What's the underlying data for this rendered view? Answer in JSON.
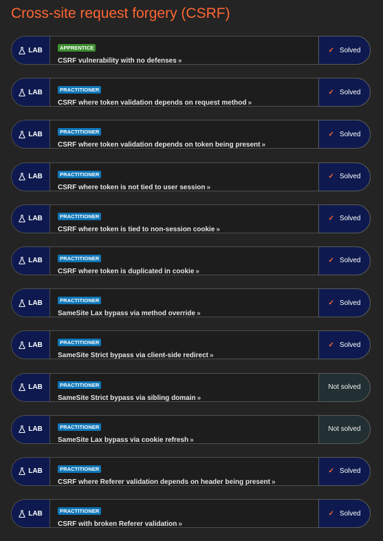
{
  "page_title": "Cross-site request forgery (CSRF)",
  "lab_badge_label": "LAB",
  "colors": {
    "title_accent": "#ff6633",
    "lab_badge_bg": "#0e1a4f",
    "apprentice": "#3e8f31",
    "practitioner": "#0f76b7",
    "solved_bg": "#0e1a4f",
    "not_solved_bg": "#233033"
  },
  "icons": {
    "badge": "flask-icon",
    "link": "double-chevron-right-icon",
    "solved": "check-icon"
  },
  "labs": [
    {
      "level": "APPRENTICE",
      "title": "CSRF vulnerability with no defenses",
      "status": "Solved"
    },
    {
      "level": "PRACTITIONER",
      "title": "CSRF where token validation depends on request method",
      "status": "Solved"
    },
    {
      "level": "PRACTITIONER",
      "title": "CSRF where token validation depends on token being present",
      "status": "Solved"
    },
    {
      "level": "PRACTITIONER",
      "title": "CSRF where token is not tied to user session",
      "status": "Solved"
    },
    {
      "level": "PRACTITIONER",
      "title": "CSRF where token is tied to non-session cookie",
      "status": "Solved"
    },
    {
      "level": "PRACTITIONER",
      "title": "CSRF where token is duplicated in cookie",
      "status": "Solved"
    },
    {
      "level": "PRACTITIONER",
      "title": "SameSite Lax bypass via method override",
      "status": "Solved"
    },
    {
      "level": "PRACTITIONER",
      "title": "SameSite Strict bypass via client-side redirect",
      "status": "Solved"
    },
    {
      "level": "PRACTITIONER",
      "title": "SameSite Strict bypass via sibling domain",
      "status": "Not solved"
    },
    {
      "level": "PRACTITIONER",
      "title": "SameSite Lax bypass via cookie refresh",
      "status": "Not solved"
    },
    {
      "level": "PRACTITIONER",
      "title": "CSRF where Referer validation depends on header being present",
      "status": "Solved"
    },
    {
      "level": "PRACTITIONER",
      "title": "CSRF with broken Referer validation",
      "status": "Solved"
    }
  ]
}
